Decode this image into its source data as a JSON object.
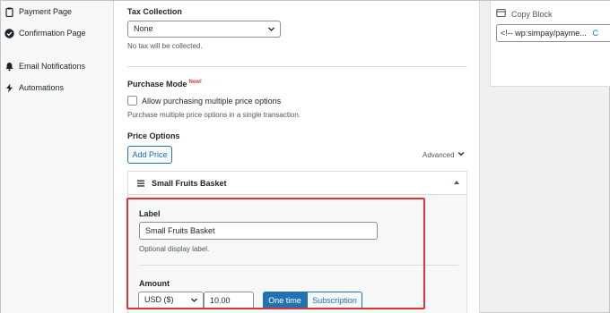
{
  "sidebar": {
    "items": [
      {
        "label": "Payment Page",
        "icon": "clipboard-icon"
      },
      {
        "label": "Confirmation Page",
        "icon": "check-circle-icon"
      },
      {
        "label": "Email Notifications",
        "icon": "bell-icon"
      },
      {
        "label": "Automations",
        "icon": "lightning-icon"
      }
    ]
  },
  "tax": {
    "title": "Tax Collection",
    "selected": "None",
    "help": "No tax will be collected."
  },
  "purchase_mode": {
    "title": "Purchase Mode",
    "badge": "New!",
    "checkbox_label": "Allow purchasing multiple price options",
    "checked": false,
    "help": "Purchase multiple price options in a single transaction."
  },
  "price_options": {
    "title": "Price Options",
    "add_button": "Add Price",
    "advanced": "Advanced",
    "item": {
      "name": "Small Fruits Basket",
      "label_title": "Label",
      "label_value": "Small Fruits Basket",
      "label_help": "Optional display label.",
      "amount_title": "Amount",
      "currency": "USD ($)",
      "amount_value": "10.00",
      "one_time": "One time",
      "subscription": "Subscription"
    }
  },
  "copy_block": {
    "title": "Copy Block",
    "code": "<!-- wp:simpay/payme...",
    "action": "C"
  },
  "colors": {
    "accent": "#2271b1",
    "highlight": "#d63638"
  }
}
